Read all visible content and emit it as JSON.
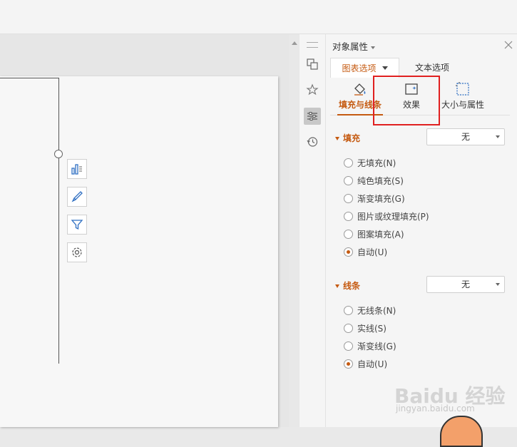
{
  "panel": {
    "title": "对象属性",
    "tabs": [
      {
        "label": "图表选项",
        "active": true
      },
      {
        "label": "文本选项",
        "active": false
      }
    ],
    "subtabs": [
      {
        "label": "填充与线条",
        "icon": "paint-bucket-icon",
        "active": true
      },
      {
        "label": "效果",
        "icon": "effects-icon",
        "active": false
      },
      {
        "label": "大小与属性",
        "icon": "size-properties-icon",
        "active": false
      }
    ],
    "fill": {
      "heading": "填充",
      "select_value": "无",
      "options": [
        {
          "label": "无填充(N)",
          "checked": false
        },
        {
          "label": "纯色填充(S)",
          "checked": false
        },
        {
          "label": "渐变填充(G)",
          "checked": false
        },
        {
          "label": "图片或纹理填充(P)",
          "checked": false
        },
        {
          "label": "图案填充(A)",
          "checked": false
        },
        {
          "label": "自动(U)",
          "checked": true
        }
      ]
    },
    "line": {
      "heading": "线条",
      "select_value": "无",
      "options": [
        {
          "label": "无线条(N)",
          "checked": false
        },
        {
          "label": "实线(S)",
          "checked": false
        },
        {
          "label": "渐变线(G)",
          "checked": false
        },
        {
          "label": "自动(U)",
          "checked": true
        }
      ]
    }
  },
  "sidebar_icons": [
    "selection-pane-icon",
    "magic-icon",
    "properties-icon",
    "history-icon"
  ],
  "chart_float_buttons": [
    "chart-elements-icon",
    "chart-style-icon",
    "chart-filter-icon",
    "chart-settings-icon"
  ],
  "watermark": {
    "brand": "Baidu 经验",
    "url": "jingyan.baidu.com"
  },
  "colors": {
    "accent": "#c55a11",
    "highlight": "#e02020",
    "panel_bg": "#f5f5f5"
  }
}
